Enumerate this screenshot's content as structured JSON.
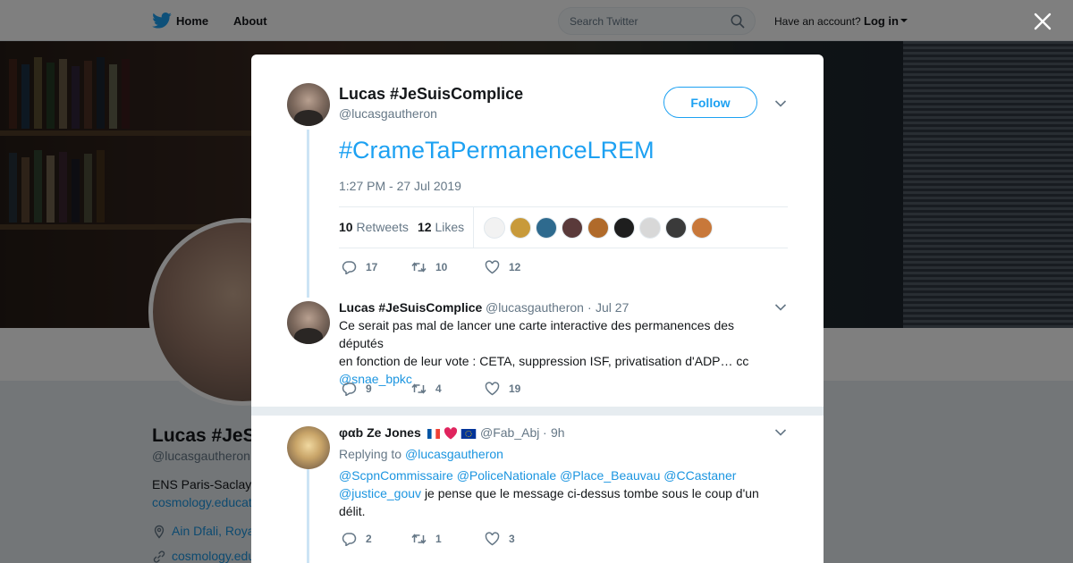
{
  "nav": {
    "home": "Home",
    "about": "About",
    "search_placeholder": "Search Twitter",
    "have_account": "Have an account?",
    "login": "Log in"
  },
  "profile": {
    "name": "Lucas #JeSuisComplice",
    "handle": "@lucasgautheron",
    "bio": "ENS Paris-Saclay",
    "link1": "cosmology.education",
    "location": "Ain Dfali, Royaume du Maroc",
    "link2": "cosmology.education"
  },
  "tweet": {
    "author_name": "Lucas #JeSuisComplice",
    "author_handle": "@lucasgautheron",
    "follow_label": "Follow",
    "text": "#CrameTaPermanenceLREM",
    "timestamp": "1:27 PM - 27 Jul 2019",
    "retweets_count": "10",
    "retweets_label": "Retweets",
    "likes_count": "12",
    "likes_label": "Likes",
    "likers": [
      "#f2f2f2",
      "#c89a3a",
      "#2e6a8e",
      "#5a3a3a",
      "#b06a2a",
      "#1e1e1e",
      "#d8d8d8",
      "#3a3a3a",
      "#c8783a"
    ],
    "actions": {
      "replies": "17",
      "retweets": "10",
      "likes": "12"
    }
  },
  "replies": [
    {
      "name": "Lucas #JeSuisComplice",
      "handle": "@lucasgautheron",
      "date": "Jul 27",
      "text_line1": "Ce serait pas mal de lancer une carte interactive des permanences des députés",
      "text_line2": "en fonction de leur vote : CETA, suppression ISF, privatisation d'ADP… cc",
      "mention": "@snae_bpkc",
      "actions": {
        "replies": "9",
        "retweets": "4",
        "likes": "19"
      }
    },
    {
      "name": "φαb Ze Jones",
      "handle": "@Fab_Abj",
      "date": "9h",
      "replying_to_label": "Replying to",
      "replying_to": "@lucasgautheron",
      "mentions_line": [
        "@ScpnCommissaire",
        "@PoliceNationale",
        "@Place_Beauvau",
        "@CCastaner"
      ],
      "mention_inline": "@justice_gouv",
      "text_after_mention": "je pense que le message ci-dessus tombe sous le coup d'un",
      "text_line3": "délit.",
      "actions": {
        "replies": "2",
        "retweets": "1",
        "likes": "3"
      }
    }
  ],
  "colors": {
    "accent": "#1da1f2",
    "link": "#1b95e0",
    "muted": "#657786",
    "thread_line": "#cce4f5"
  }
}
